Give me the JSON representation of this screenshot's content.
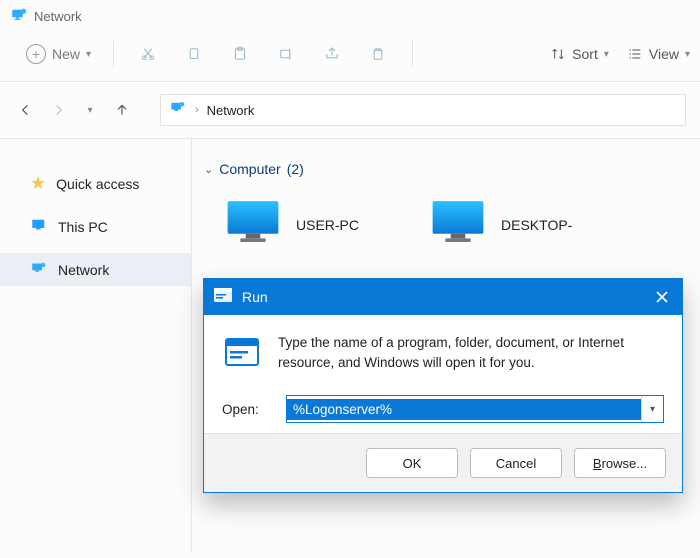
{
  "window": {
    "title": "Network"
  },
  "toolbar": {
    "new_label": "New",
    "sort_label": "Sort",
    "view_label": "View"
  },
  "breadcrumb": {
    "location": "Network"
  },
  "sidebar": {
    "items": [
      {
        "label": "Quick access"
      },
      {
        "label": "This PC"
      },
      {
        "label": "Network"
      }
    ]
  },
  "content": {
    "group_label": "Computer",
    "group_count": "(2)",
    "computers": [
      {
        "name": "USER-PC"
      },
      {
        "name": "DESKTOP-"
      }
    ]
  },
  "run_dialog": {
    "title": "Run",
    "description": "Type the name of a program, folder, document, or Internet resource, and Windows will open it for you.",
    "open_label": "Open:",
    "input_value": "%Logonserver%",
    "ok": "OK",
    "cancel": "Cancel",
    "browse": "Browse..."
  }
}
